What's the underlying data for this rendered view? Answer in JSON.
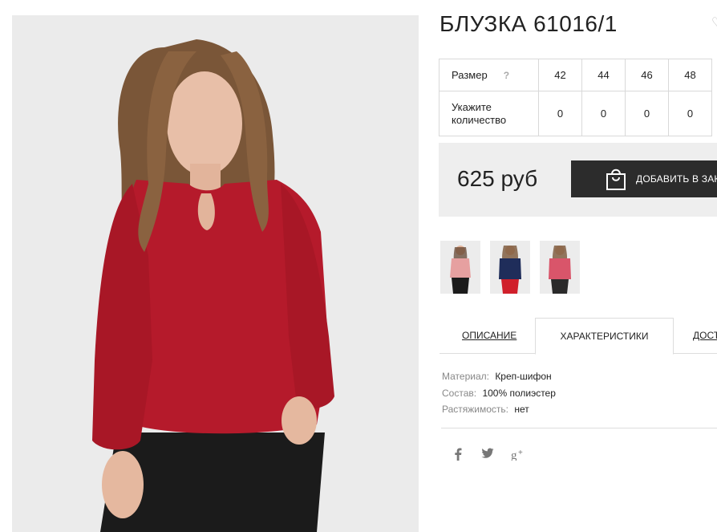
{
  "product": {
    "title": "БЛУЗКА 61016/1",
    "price": "625 руб",
    "add_to_cart_label": "ДОБАВИТЬ В ЗАКАЗ"
  },
  "size_table": {
    "size_label": "Размер",
    "help_mark": "?",
    "qty_label": "Укажите количество",
    "sizes": [
      "42",
      "44",
      "46",
      "48"
    ],
    "quantities": [
      "0",
      "0",
      "0",
      "0"
    ]
  },
  "thumbnails": [
    {
      "name": "pink blouse"
    },
    {
      "name": "navy blouse"
    },
    {
      "name": "coral blouse"
    }
  ],
  "tabs": [
    {
      "label": "ОПИСАНИЕ",
      "active": false
    },
    {
      "label": "ХАРАКТЕРИСТИКИ",
      "active": true
    },
    {
      "label": "ДОСТАВКА",
      "active": false
    }
  ],
  "specs": [
    {
      "key": "Материал:",
      "value": "Креп-шифон"
    },
    {
      "key": "Состав:",
      "value": "100% полиэстер"
    },
    {
      "key": "Растяжимость:",
      "value": "нет"
    }
  ],
  "social": [
    {
      "icon": "facebook-icon",
      "glyph": "f"
    },
    {
      "icon": "twitter-icon",
      "glyph": "t"
    },
    {
      "icon": "google-plus-icon",
      "glyph": "g+"
    }
  ],
  "colors": {
    "blouse_red": "#b51a2b",
    "dark_button": "#2c2c2c",
    "price_bg": "#eeeeee"
  }
}
